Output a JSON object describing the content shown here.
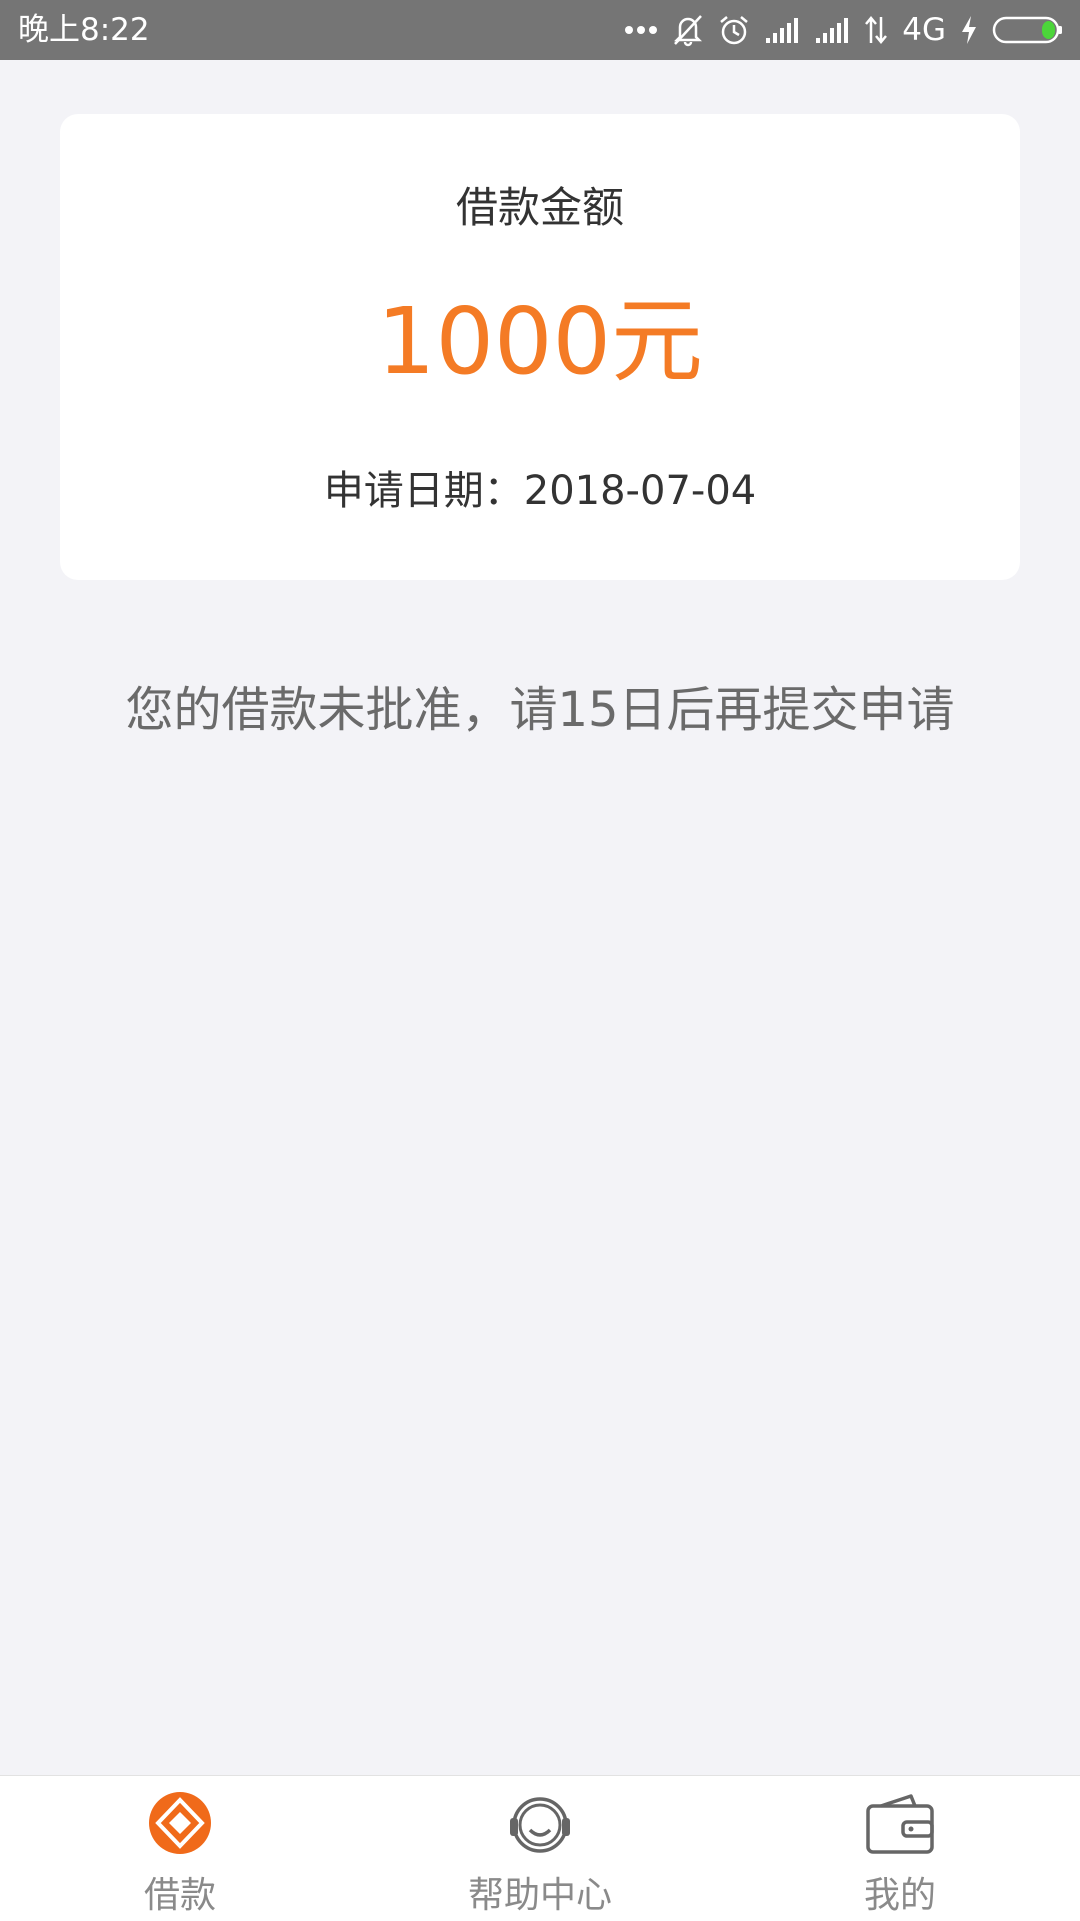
{
  "status_bar": {
    "time": "晚上8:22",
    "network": "4G",
    "icons": [
      "more-dots-icon",
      "bell-muted-icon",
      "alarm-icon",
      "signal-icon",
      "signal-icon",
      "data-transfer-icon",
      "charging-icon",
      "battery-icon"
    ]
  },
  "loan_card": {
    "title": "借款金额",
    "amount": "1000元",
    "date_text": "申请日期：2018-07-04"
  },
  "notice": "您的借款未批准，请15日后再提交申请",
  "tab_bar": {
    "tabs": [
      {
        "label": "借款",
        "icon": "loan-diamond-icon",
        "active": true
      },
      {
        "label": "帮助中心",
        "icon": "headset-icon",
        "active": false
      },
      {
        "label": "我的",
        "icon": "wallet-icon",
        "active": false
      }
    ]
  },
  "colors": {
    "accent": "#f47b25",
    "background": "#f3f3f7",
    "status_bar": "#757575",
    "battery_fill": "#4cd53a"
  }
}
